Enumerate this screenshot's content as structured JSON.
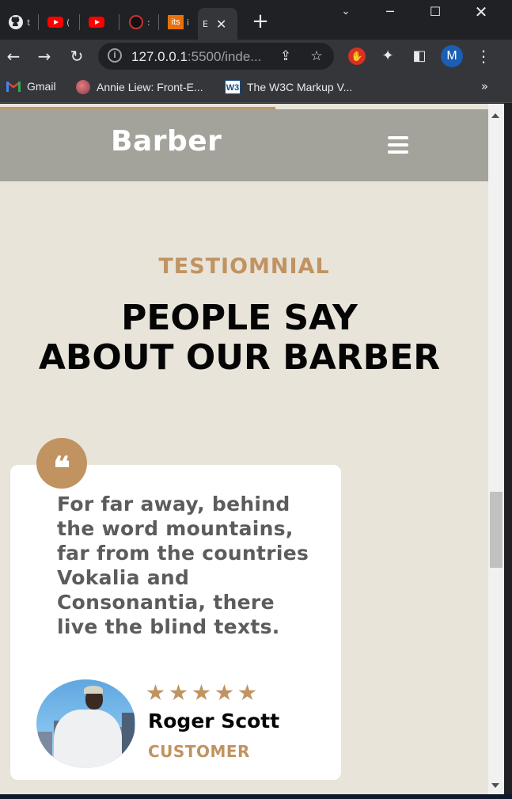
{
  "browser": {
    "tabs": [
      {
        "icon": "github-icon",
        "label": "t"
      },
      {
        "icon": "youtube-icon",
        "label": "("
      },
      {
        "icon": "youtube-icon",
        "label": ""
      },
      {
        "icon": "site-icon",
        "label": ":"
      },
      {
        "icon": "its-icon",
        "favicon_text": "its",
        "label": "i"
      },
      {
        "icon": "page-icon",
        "label": "E",
        "active": true
      }
    ],
    "new_tab_glyph": "+",
    "url_host": "127.0.0.1",
    "url_rest": ":5500/inde...",
    "profile_initial": "M",
    "bookmarks": [
      {
        "icon": "gmail-icon",
        "label": "Gmail"
      },
      {
        "icon": "annie-icon",
        "label": "Annie Liew: Front-E..."
      },
      {
        "icon": "w3c-icon",
        "favicon_text": "W3",
        "label": "The W3C Markup V..."
      }
    ],
    "bookmarks_more": "»"
  },
  "site": {
    "logo": "Barber",
    "testimonial": {
      "eyebrow": "TESTIOMNIAL",
      "heading_line1": "PEOPLE SAY",
      "heading_line2": "ABOUT OUR BARBER",
      "quote_glyph": "❝",
      "quote": "For far away, behind the word mountains, far from the countries Vokalia and Consonantia, there live the blind texts.",
      "rating": 5,
      "name": "Roger Scott",
      "role": "CUSTOMER"
    }
  },
  "colors": {
    "accent": "#c09360",
    "page_bg": "#e8e4da",
    "header_bg": "#a3a39c",
    "card_bg": "#ffffff"
  }
}
